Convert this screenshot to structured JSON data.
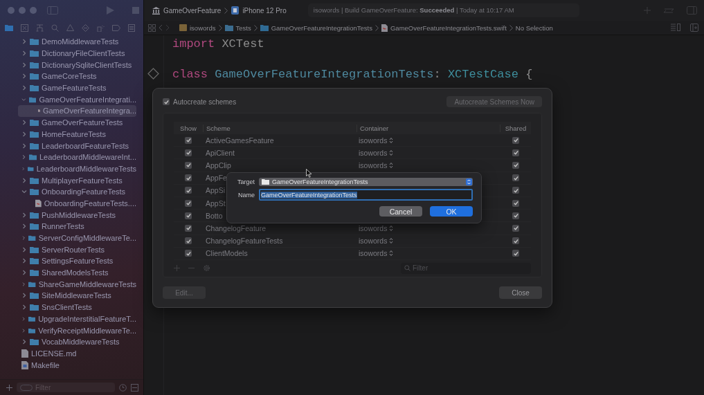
{
  "toolbar": {
    "scheme": "GameOverFeature",
    "device": "iPhone 12 Pro",
    "status": "isowords | Build GameOverFeature: **Succeeded** | Today at 10:17 AM"
  },
  "breadcrumb": [
    {
      "label": "isowords",
      "kind": "project"
    },
    {
      "label": "Tests",
      "kind": "group"
    },
    {
      "label": "GameOverFeatureIntegrationTests",
      "kind": "folder"
    },
    {
      "label": "GameOverFeatureIntegrationTests.swift",
      "kind": "file"
    },
    {
      "label": "No Selection",
      "kind": "text"
    }
  ],
  "navigator": {
    "items": [
      {
        "label": "DemoMiddlewareTests",
        "kind": "folder",
        "expanded": false,
        "selected": false
      },
      {
        "label": "DictionaryFileClientTests",
        "kind": "folder",
        "expanded": false,
        "selected": false
      },
      {
        "label": "DictionarySqliteClientTests",
        "kind": "folder",
        "expanded": false,
        "selected": false
      },
      {
        "label": "GameCoreTests",
        "kind": "folder",
        "expanded": false,
        "selected": false
      },
      {
        "label": "GameFeatureTests",
        "kind": "folder",
        "expanded": false,
        "selected": false
      },
      {
        "label": "GameOverFeatureIntegrati...",
        "kind": "folder",
        "expanded": true,
        "selected": false,
        "children": [
          {
            "label": "GameOverFeatureIntegra...",
            "kind": "swift",
            "selected": true
          }
        ]
      },
      {
        "label": "GameOverFeatureTests",
        "kind": "folder",
        "expanded": false,
        "selected": false
      },
      {
        "label": "HomeFeatureTests",
        "kind": "folder",
        "expanded": false,
        "selected": false
      },
      {
        "label": "LeaderboardFeatureTests",
        "kind": "folder",
        "expanded": false,
        "selected": false
      },
      {
        "label": "LeaderboardMiddlewareInt...",
        "kind": "folder",
        "expanded": false,
        "selected": false
      },
      {
        "label": "LeaderboardMiddlewareTests",
        "kind": "folder",
        "expanded": false,
        "selected": false
      },
      {
        "label": "MultiplayerFeatureTests",
        "kind": "folder",
        "expanded": false,
        "selected": false
      },
      {
        "label": "OnboardingFeatureTests",
        "kind": "folder",
        "expanded": true,
        "selected": false,
        "children": [
          {
            "label": "OnboardingFeatureTests....",
            "kind": "swift",
            "selected": false
          }
        ]
      },
      {
        "label": "PushMiddlewareTests",
        "kind": "folder",
        "expanded": false,
        "selected": false
      },
      {
        "label": "RunnerTests",
        "kind": "folder",
        "expanded": false,
        "selected": false
      },
      {
        "label": "ServerConfigMiddlewareTe...",
        "kind": "folder",
        "expanded": false,
        "selected": false
      },
      {
        "label": "ServerRouterTests",
        "kind": "folder",
        "expanded": false,
        "selected": false
      },
      {
        "label": "SettingsFeatureTests",
        "kind": "folder",
        "expanded": false,
        "selected": false
      },
      {
        "label": "SharedModelsTests",
        "kind": "folder",
        "expanded": false,
        "selected": false
      },
      {
        "label": "ShareGameMiddlewareTests",
        "kind": "folder",
        "expanded": false,
        "selected": false
      },
      {
        "label": "SiteMiddlewareTests",
        "kind": "folder",
        "expanded": false,
        "selected": false
      },
      {
        "label": "SnsClientTests",
        "kind": "folder",
        "expanded": false,
        "selected": false
      },
      {
        "label": "UpgradeInterstitialFeatureT...",
        "kind": "folder",
        "expanded": false,
        "selected": false
      },
      {
        "label": "VerifyReceiptMiddlewareTe...",
        "kind": "folder",
        "expanded": false,
        "selected": false
      },
      {
        "label": "VocabMiddlewareTests",
        "kind": "folder",
        "expanded": false,
        "selected": false
      },
      {
        "label": "LICENSE.md",
        "kind": "doc",
        "selected": false
      },
      {
        "label": "Makefile",
        "kind": "makefile",
        "selected": false
      }
    ],
    "filter": {
      "placeholder": "Filter"
    }
  },
  "editor": {
    "lines": [
      [
        {
          "text": "import",
          "kind": "keyword"
        },
        {
          "text": "XCTest",
          "kind": "plain"
        }
      ],
      [
        {
          "text": "class",
          "kind": "keyword"
        },
        {
          "text": "GameOverFeatureIntegrationTests",
          "kind": "decl"
        },
        {
          "text": ":",
          "kind": "plain"
        },
        {
          "text": "XCTestCase",
          "kind": "type"
        },
        {
          "text": "{",
          "kind": "plain"
        }
      ]
    ]
  },
  "scheme_sheet": {
    "autocreate": {
      "label": "Autocreate schemes",
      "checked": true
    },
    "autocreate_now": {
      "label": "Autocreate Schemes Now",
      "disabled": true
    },
    "columns": [
      "Show",
      "Scheme",
      "Container",
      "Shared"
    ],
    "rows": [
      {
        "scheme": "ActiveGamesFeature",
        "container": "isowords",
        "show": true,
        "shared": true
      },
      {
        "scheme": "ApiClient",
        "container": "isowords",
        "show": true,
        "shared": true
      },
      {
        "scheme": "AppClip",
        "container": "isowords",
        "show": true,
        "shared": true
      },
      {
        "scheme": "AppFe",
        "show": true,
        "shared": true
      },
      {
        "scheme": "AppSi",
        "show": true,
        "shared": true
      },
      {
        "scheme": "AppSt",
        "show": true,
        "shared": true
      },
      {
        "scheme": "Botto",
        "show": true,
        "shared": true
      },
      {
        "scheme": "ChangelogFeature",
        "container": "isowords",
        "show": true,
        "shared": true
      },
      {
        "scheme": "ChangelogFeatureTests",
        "container": "isowords",
        "show": true,
        "shared": true
      },
      {
        "scheme": "ClientModels",
        "container": "isowords",
        "show": true,
        "shared": true
      }
    ],
    "filter": {
      "placeholder": "Filter"
    },
    "edit": {
      "label": "Edit...",
      "disabled": true
    },
    "close": {
      "label": "Close",
      "disabled": false
    }
  },
  "target_dialog": {
    "target_label": "Target",
    "target": "GameOverFeatureIntegrationTests",
    "name_label": "Name",
    "name": "GameOverFeatureIntegrationTests",
    "cancel": "Cancel",
    "ok": "OK"
  }
}
